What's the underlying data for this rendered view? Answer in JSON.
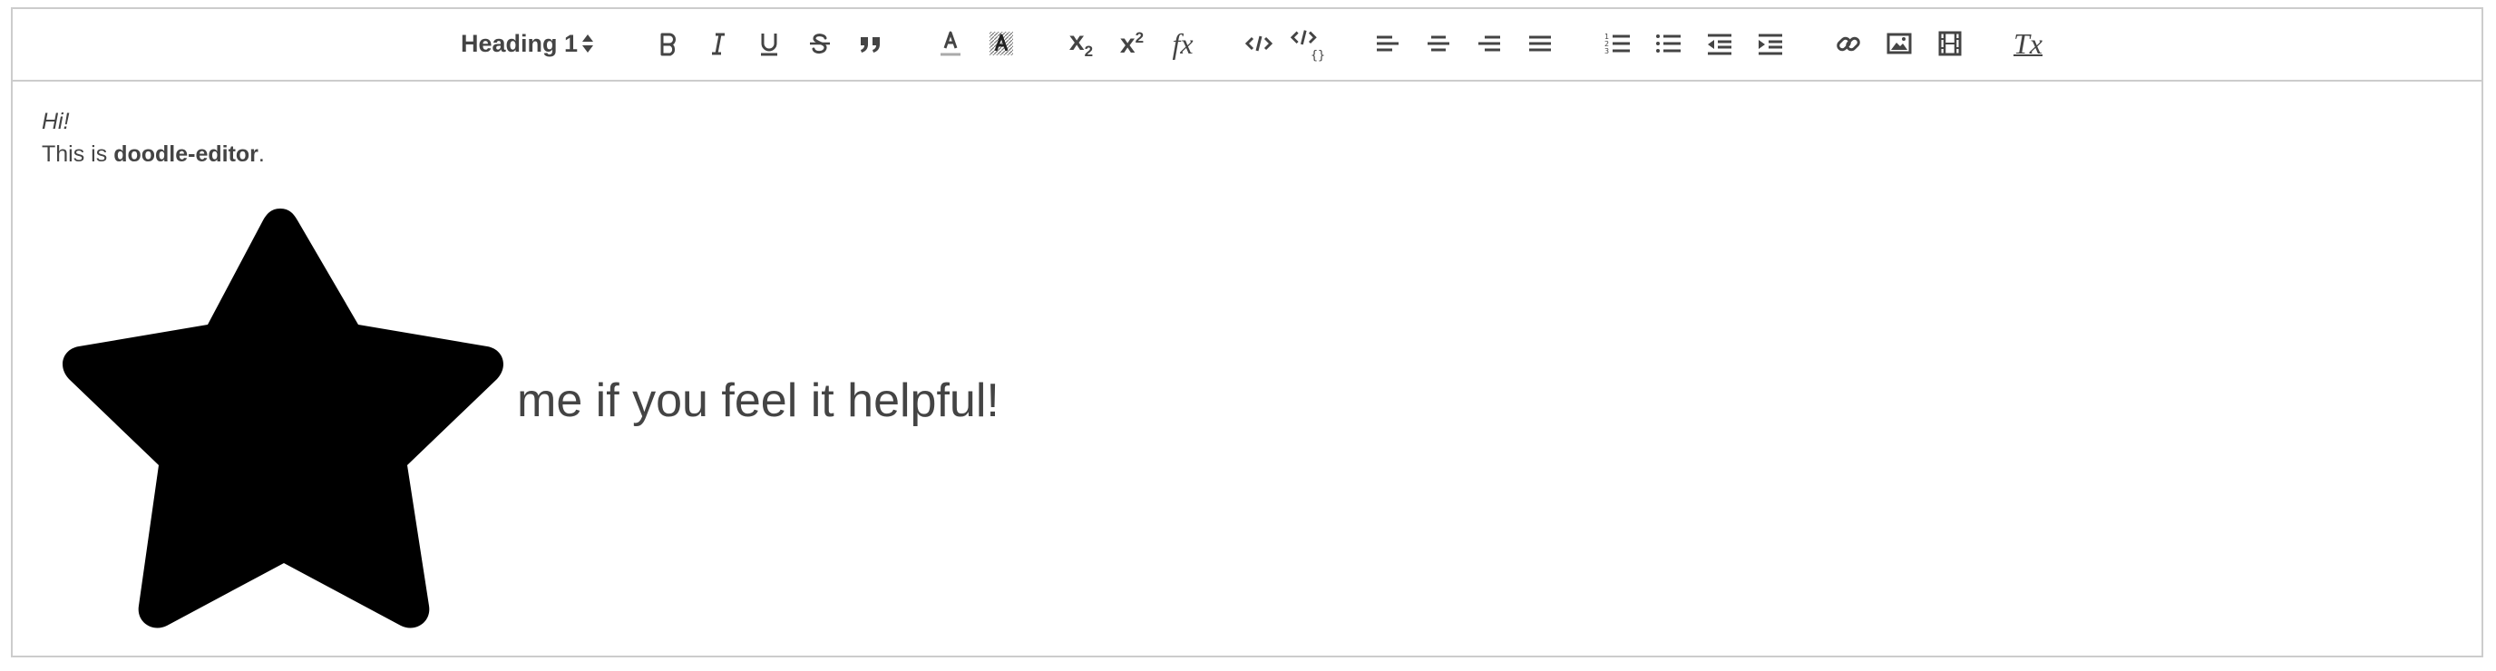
{
  "toolbar": {
    "heading_label": "Heading 1",
    "subscript": {
      "base": "x",
      "mark": "2"
    },
    "superscript": {
      "base": "x",
      "mark": "2"
    },
    "formula": "fx",
    "clear_format": "Tx",
    "buttons": [
      "bold",
      "italic",
      "underline",
      "strike",
      "blockquote",
      "text-color",
      "background-color",
      "subscript",
      "superscript",
      "formula",
      "code",
      "code-block",
      "align-left",
      "align-center",
      "align-right",
      "align-justify",
      "ordered-list",
      "bullet-list",
      "outdent",
      "indent",
      "link",
      "image",
      "video",
      "clear-format"
    ]
  },
  "content": {
    "greeting": "Hi!",
    "intro_prefix": "This is ",
    "intro_bold": "doodle-editor",
    "intro_suffix": ".",
    "image": "star-image",
    "big_text": "me if you feel it helpful!"
  },
  "colors": {
    "border": "#cccccc",
    "icon": "#444444",
    "text": "#444444",
    "star": "#000000"
  }
}
